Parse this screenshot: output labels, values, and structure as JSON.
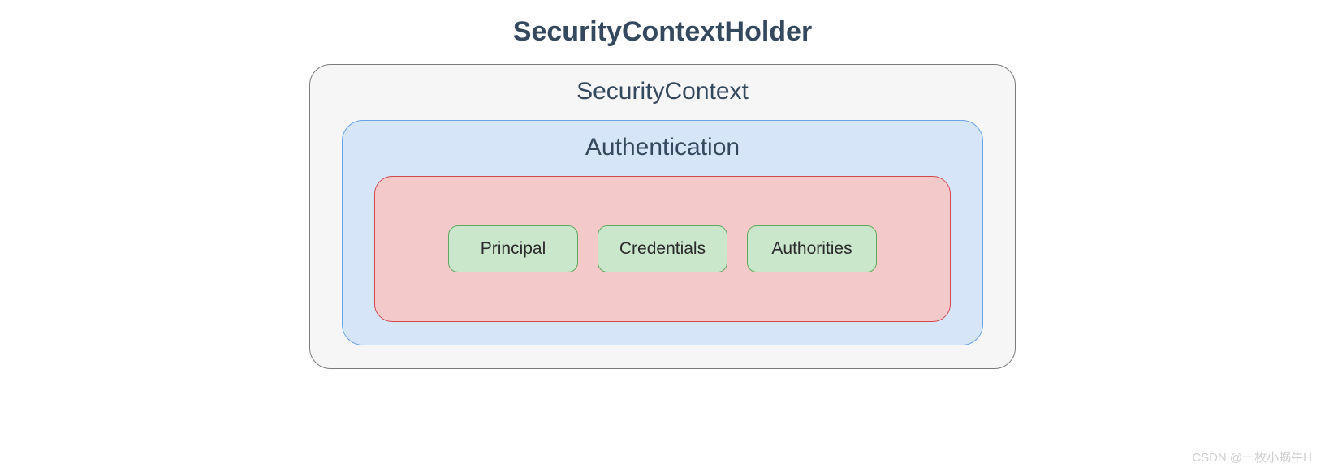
{
  "diagram": {
    "title": "SecurityContextHolder",
    "securityContext": {
      "label": "SecurityContext",
      "authentication": {
        "label": "Authentication",
        "items": [
          {
            "label": "Principal"
          },
          {
            "label": "Credentials"
          },
          {
            "label": "Authorities"
          }
        ]
      }
    }
  },
  "watermark": "CSDN @一枚小蜗牛H"
}
